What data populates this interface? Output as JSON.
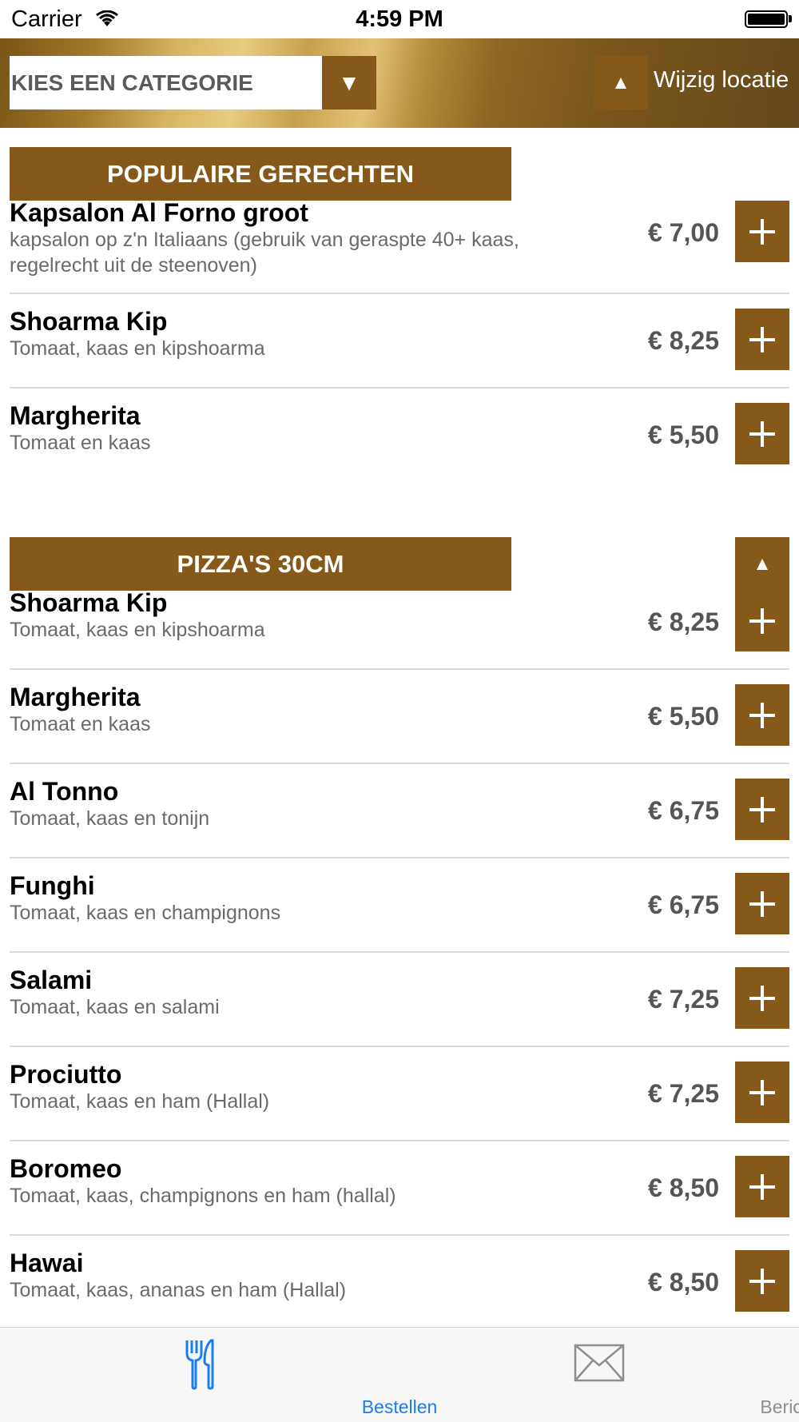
{
  "status_bar": {
    "carrier": "Carrier",
    "time": "4:59 PM"
  },
  "header": {
    "category_placeholder": "KIES EEN CATEGORIE",
    "location_label": "Wijzig locatie"
  },
  "sections": [
    {
      "title": "POPULAIRE GERECHTEN",
      "items": [
        {
          "name": "Kapsalon Al Forno groot",
          "desc": "kapsalon op z'n Italiaans (gebruik van geraspte 40+ kaas, regelrecht uit de steenoven)",
          "price": "€ 7,00"
        },
        {
          "name": "Shoarma Kip",
          "desc": "Tomaat, kaas en kipshoarma",
          "price": "€ 8,25"
        },
        {
          "name": "Margherita",
          "desc": "Tomaat en kaas",
          "price": "€ 5,50"
        }
      ]
    },
    {
      "title": "PIZZA'S 30CM",
      "items": [
        {
          "name": "Shoarma Kip",
          "desc": "Tomaat, kaas en kipshoarma",
          "price": "€ 8,25"
        },
        {
          "name": "Margherita",
          "desc": "Tomaat en kaas",
          "price": "€ 5,50"
        },
        {
          "name": "Al Tonno",
          "desc": "Tomaat, kaas en tonijn",
          "price": "€ 6,75"
        },
        {
          "name": "Funghi",
          "desc": "Tomaat, kaas en champignons",
          "price": "€ 6,75"
        },
        {
          "name": "Salami",
          "desc": "Tomaat, kaas en salami",
          "price": "€ 7,25"
        },
        {
          "name": "Prociutto",
          "desc": "Tomaat, kaas en ham (Hallal)",
          "price": "€ 7,25"
        },
        {
          "name": "Boromeo",
          "desc": "Tomaat, kaas, champignons en ham (hallal)",
          "price": "€ 8,50"
        },
        {
          "name": "Hawai",
          "desc": "Tomaat, kaas, ananas en ham (Hallal)",
          "price": "€ 8,50"
        }
      ]
    }
  ],
  "tabbar": {
    "tabs": [
      {
        "label": "Bestellen",
        "icon": "fork-knife-icon",
        "active": true
      },
      {
        "label": "Berichten",
        "icon": "envelope-icon",
        "active": false
      }
    ]
  },
  "colors": {
    "accent": "#86591a",
    "tab_active": "#1a7cf0",
    "tab_inactive": "#8e8e8e"
  }
}
